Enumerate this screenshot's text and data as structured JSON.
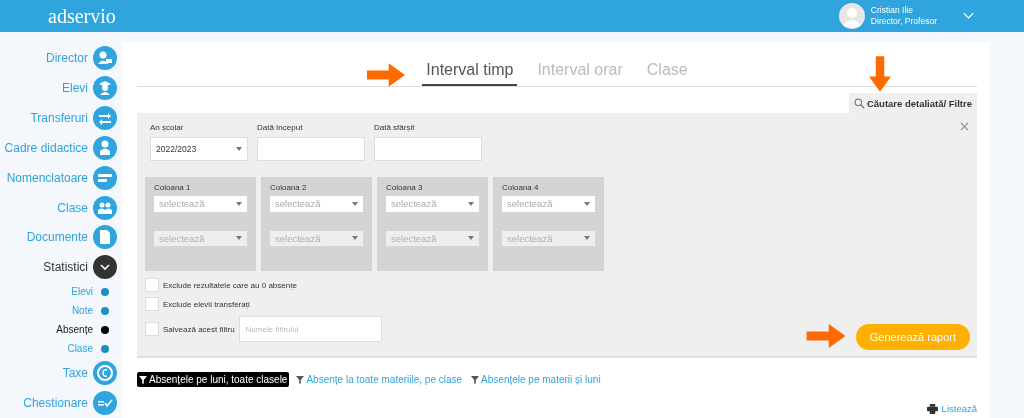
{
  "header": {
    "logo": "adservio",
    "user": {
      "name": "Cristian Ilie",
      "role": "Director, Profesor"
    }
  },
  "sidebar": {
    "items": [
      {
        "label": "Director",
        "kind": "link"
      },
      {
        "label": "Elevi",
        "kind": "link"
      },
      {
        "label": "Transferuri",
        "kind": "link"
      },
      {
        "label": "Cadre didactice",
        "kind": "link"
      },
      {
        "label": "Nomenclatoare",
        "kind": "link"
      },
      {
        "label": "Clase",
        "kind": "link"
      },
      {
        "label": "Documente",
        "kind": "link"
      },
      {
        "label": "Statistici",
        "kind": "group",
        "expanded": true,
        "children": [
          {
            "label": "Elevi",
            "selected": false
          },
          {
            "label": "Note",
            "selected": false
          },
          {
            "label": "Absențe",
            "selected": true
          },
          {
            "label": "Clase",
            "selected": false
          }
        ]
      },
      {
        "label": "Taxe",
        "kind": "link"
      },
      {
        "label": "Chestionare",
        "kind": "link"
      }
    ]
  },
  "tabs": [
    {
      "label": "Interval timp",
      "selected": true
    },
    {
      "label": "Interval orar",
      "selected": false
    },
    {
      "label": "Clase",
      "selected": false
    }
  ],
  "filter_panel": {
    "title": "Căutare detaliată/ Filtre",
    "fields": [
      {
        "label": "An școlar",
        "kind": "select",
        "value": "2022/2023"
      },
      {
        "label": "Dată început",
        "kind": "text"
      },
      {
        "label": "Dată sfârșit",
        "kind": "text"
      }
    ],
    "columns": [
      {
        "title": "Coloana 1",
        "selects": [
          {
            "placeholder": "selectează",
            "disabled": false
          },
          {
            "placeholder": "selectează",
            "disabled": true
          }
        ]
      },
      {
        "title": "Coloana 2",
        "selects": [
          {
            "placeholder": "selectează",
            "disabled": false
          },
          {
            "placeholder": "selectează",
            "disabled": true
          }
        ]
      },
      {
        "title": "Coloana 3",
        "selects": [
          {
            "placeholder": "selectează",
            "disabled": false
          },
          {
            "placeholder": "selectează",
            "disabled": true
          }
        ]
      },
      {
        "title": "Coloana 4",
        "selects": [
          {
            "placeholder": "selectează",
            "disabled": false
          },
          {
            "placeholder": "selectează",
            "disabled": true
          }
        ]
      }
    ],
    "options": [
      {
        "label": "Exclude rezultatele care au 0 absențe",
        "checked": false
      },
      {
        "label": "Exclude elevii transferați",
        "checked": false
      },
      {
        "label": "Salvează acest filtru",
        "checked": false,
        "placeholder": "Numele filtrului"
      }
    ],
    "button": "Generează raport"
  },
  "reports": [
    {
      "label": "Absențele pe luni, toate clasele",
      "selected": true
    },
    {
      "label": "Absențe la toate materiile, pe clase",
      "selected": false
    },
    {
      "label": "Absențele pe materii și luni",
      "selected": false
    }
  ],
  "print": "Listează"
}
